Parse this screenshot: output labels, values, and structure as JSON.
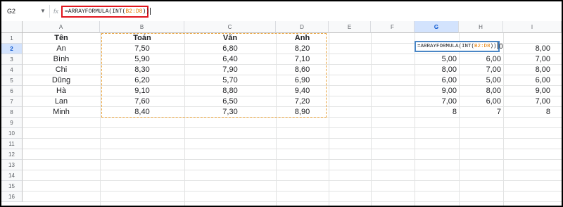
{
  "formula_bar": {
    "name_box": "G2",
    "fx_symbol": "fx",
    "formula_prefix": "=ARRAYFORMULA(INT(",
    "formula_range": "B2:D8",
    "formula_suffix": "))"
  },
  "columns": [
    "A",
    "B",
    "C",
    "D",
    "E",
    "F",
    "G",
    "H",
    "I"
  ],
  "rows": [
    "1",
    "2",
    "3",
    "4",
    "5",
    "6",
    "7",
    "8",
    "9",
    "10",
    "11",
    "12",
    "13",
    "14",
    "15",
    "16"
  ],
  "sheet": {
    "headers": [
      "Tên",
      "Toán",
      "Văn",
      "Anh"
    ],
    "students": [
      {
        "name": "An",
        "toan": "7,50",
        "van": "6,80",
        "anh": "8,20",
        "g": "",
        "h": "",
        "i": "8,00"
      },
      {
        "name": "Bình",
        "toan": "5,90",
        "van": "6,40",
        "anh": "7,10",
        "g": "5,00",
        "h": "6,00",
        "i": "7,00"
      },
      {
        "name": "Chi",
        "toan": "8,30",
        "van": "7,90",
        "anh": "8,60",
        "g": "8,00",
        "h": "7,00",
        "i": "8,00"
      },
      {
        "name": "Dũng",
        "toan": "6,20",
        "van": "5,70",
        "anh": "6,90",
        "g": "6,00",
        "h": "5,00",
        "i": "6,00"
      },
      {
        "name": "Hà",
        "toan": "9,10",
        "van": "8,80",
        "anh": "9,40",
        "g": "9,00",
        "h": "8,00",
        "i": "9,00"
      },
      {
        "name": "Lan",
        "toan": "7,60",
        "van": "6,50",
        "anh": "7,20",
        "g": "7,00",
        "h": "6,00",
        "i": "7,00"
      },
      {
        "name": "Minh",
        "toan": "8,40",
        "van": "7,30",
        "anh": "8,90",
        "g": "8",
        "h": "7",
        "i": "8"
      }
    ],
    "active_cell_formula_prefix": "=ARRAYFORMULA(INT(",
    "active_cell_formula_range": "B2:D8",
    "active_cell_formula_suffix": "))",
    "active_cell_trailing": "0"
  },
  "colors": {
    "selection_border": "#4a86c5",
    "range_highlight": "#e8a23a",
    "formula_bar_highlight": "#e0161e"
  }
}
